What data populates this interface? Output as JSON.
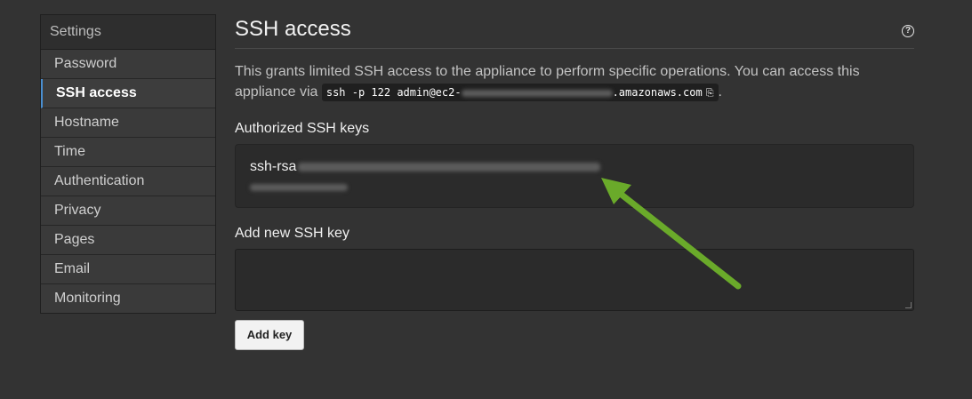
{
  "sidebar": {
    "header": "Settings",
    "items": [
      {
        "label": "Password"
      },
      {
        "label": "SSH access"
      },
      {
        "label": "Hostname"
      },
      {
        "label": "Time"
      },
      {
        "label": "Authentication"
      },
      {
        "label": "Privacy"
      },
      {
        "label": "Pages"
      },
      {
        "label": "Email"
      },
      {
        "label": "Monitoring"
      }
    ],
    "active_index": 1
  },
  "main": {
    "title": "SSH access",
    "help_icon": "question-circle-icon",
    "description_pre": "This grants limited SSH access to the appliance to perform specific operations. You can access this appliance via ",
    "command_prefix": "ssh -p 122 admin@ec2-",
    "command_suffix": ".amazonaws.com",
    "copy_icon": "clipboard-icon",
    "description_post": ".",
    "authorized_label": "Authorized SSH keys",
    "key_prefix": "ssh-rsa",
    "add_label": "Add new SSH key",
    "add_button": "Add key"
  },
  "colors": {
    "background": "#333333",
    "accent": "#4a8fd1",
    "arrow": "#6aaa2a"
  }
}
